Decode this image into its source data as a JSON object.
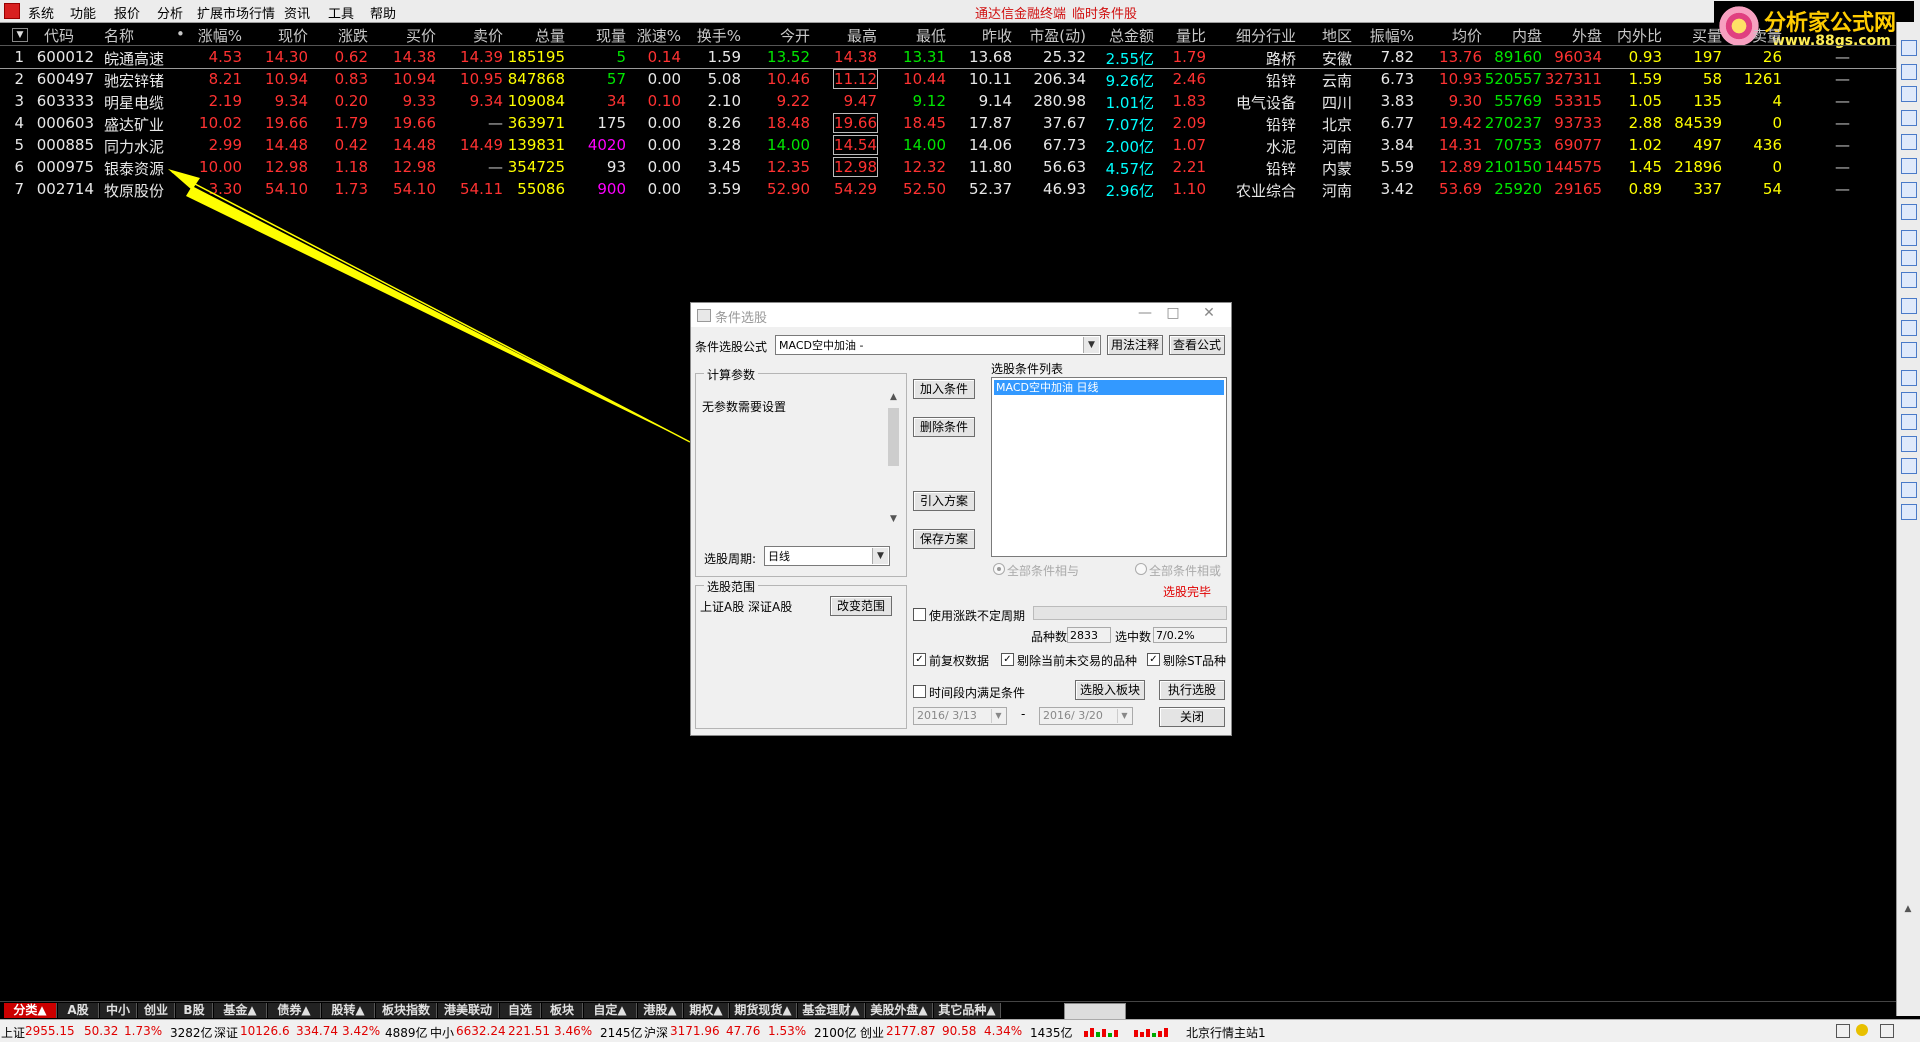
{
  "menubar": {
    "items": [
      "系统",
      "功能",
      "报价",
      "分析",
      "扩展市场行情",
      "资讯",
      "工具",
      "帮助"
    ],
    "title_left": "通达信金融终端",
    "title_right": "临时条件股",
    "restore_label": "行"
  },
  "brand": {
    "title": "分析家公式网",
    "url": "www.88gs.com"
  },
  "table": {
    "headers": [
      "代码",
      "名称",
      "•",
      "涨幅%",
      "现价",
      "涨跌",
      "买价",
      "卖价",
      "总量",
      "现量",
      "涨速%",
      "换手%",
      "今开",
      "最高",
      "最低",
      "昨收",
      "市盈(动)",
      "总金额",
      "量比",
      "细分行业",
      "地区",
      "振幅%",
      "均价",
      "内盘",
      "外盘",
      "内外比",
      "买量",
      "卖量"
    ],
    "rows": [
      {
        "idx": "1",
        "code": "600012",
        "name": "皖通高速",
        "chg_pct": "4.53",
        "price": "14.30",
        "chg": "0.62",
        "bid": "14.38",
        "ask": "14.39",
        "vol": "185195",
        "cur_vol": "5",
        "speed": "0.14",
        "turnover": "1.59",
        "open": "13.52",
        "high": "14.38",
        "low": "13.31",
        "prev": "13.68",
        "pe": "25.32",
        "amount": "2.55亿",
        "vol_ratio": "1.79",
        "industry": "路桥",
        "region": "安徽",
        "amplitude": "7.82",
        "avg": "13.76",
        "inner": "89160",
        "outer": "96034",
        "io_ratio": "0.93",
        "buy_vol": "197",
        "sell_vol": "26"
      },
      {
        "idx": "2",
        "code": "600497",
        "name": "驰宏锌锗",
        "chg_pct": "8.21",
        "price": "10.94",
        "chg": "0.83",
        "bid": "10.94",
        "ask": "10.95",
        "vol": "847868",
        "cur_vol": "57",
        "speed": "0.00",
        "turnover": "5.08",
        "open": "10.46",
        "high": "11.12",
        "low": "10.44",
        "prev": "10.11",
        "pe": "206.34",
        "amount": "9.26亿",
        "vol_ratio": "2.46",
        "industry": "铅锌",
        "region": "云南",
        "amplitude": "6.73",
        "avg": "10.93",
        "inner": "520557",
        "outer": "327311",
        "io_ratio": "1.59",
        "buy_vol": "58",
        "sell_vol": "1261"
      },
      {
        "idx": "3",
        "code": "603333",
        "name": "明星电缆",
        "chg_pct": "2.19",
        "price": "9.34",
        "chg": "0.20",
        "bid": "9.33",
        "ask": "9.34",
        "vol": "109084",
        "cur_vol": "34",
        "speed": "0.10",
        "turnover": "2.10",
        "open": "9.22",
        "high": "9.47",
        "low": "9.12",
        "prev": "9.14",
        "pe": "280.98",
        "amount": "1.01亿",
        "vol_ratio": "1.83",
        "industry": "电气设备",
        "region": "四川",
        "amplitude": "3.83",
        "avg": "9.30",
        "inner": "55769",
        "outer": "53315",
        "io_ratio": "1.05",
        "buy_vol": "135",
        "sell_vol": "4"
      },
      {
        "idx": "4",
        "code": "000603",
        "name": "盛达矿业",
        "chg_pct": "10.02",
        "price": "19.66",
        "chg": "1.79",
        "bid": "19.66",
        "ask": "—",
        "vol": "363971",
        "cur_vol": "175",
        "speed": "0.00",
        "turnover": "8.26",
        "open": "18.48",
        "high": "19.66",
        "low": "18.45",
        "prev": "17.87",
        "pe": "37.67",
        "amount": "7.07亿",
        "vol_ratio": "2.09",
        "industry": "铅锌",
        "region": "北京",
        "amplitude": "6.77",
        "avg": "19.42",
        "inner": "270237",
        "outer": "93733",
        "io_ratio": "2.88",
        "buy_vol": "84539",
        "sell_vol": "0"
      },
      {
        "idx": "5",
        "code": "000885",
        "name": "同力水泥",
        "chg_pct": "2.99",
        "price": "14.48",
        "chg": "0.42",
        "bid": "14.48",
        "ask": "14.49",
        "vol": "139831",
        "cur_vol": "4020",
        "speed": "0.00",
        "turnover": "3.28",
        "open": "14.00",
        "high": "14.54",
        "low": "14.00",
        "prev": "14.06",
        "pe": "67.73",
        "amount": "2.00亿",
        "vol_ratio": "1.07",
        "industry": "水泥",
        "region": "河南",
        "amplitude": "3.84",
        "avg": "14.31",
        "inner": "70753",
        "outer": "69077",
        "io_ratio": "1.02",
        "buy_vol": "497",
        "sell_vol": "436"
      },
      {
        "idx": "6",
        "code": "000975",
        "name": "银泰资源",
        "chg_pct": "10.00",
        "price": "12.98",
        "chg": "1.18",
        "bid": "12.98",
        "ask": "—",
        "vol": "354725",
        "cur_vol": "93",
        "speed": "0.00",
        "turnover": "3.45",
        "open": "12.35",
        "high": "12.98",
        "low": "12.32",
        "prev": "11.80",
        "pe": "56.63",
        "amount": "4.57亿",
        "vol_ratio": "2.21",
        "industry": "铅锌",
        "region": "内蒙",
        "amplitude": "5.59",
        "avg": "12.89",
        "inner": "210150",
        "outer": "144575",
        "io_ratio": "1.45",
        "buy_vol": "21896",
        "sell_vol": "0"
      },
      {
        "idx": "7",
        "code": "002714",
        "name": "牧原股份",
        "chg_pct": "3.30",
        "price": "54.10",
        "chg": "1.73",
        "bid": "54.10",
        "ask": "54.11",
        "vol": "55086",
        "cur_vol": "900",
        "speed": "0.00",
        "turnover": "3.59",
        "open": "52.90",
        "high": "54.29",
        "low": "52.50",
        "prev": "52.37",
        "pe": "46.93",
        "amount": "2.96亿",
        "vol_ratio": "1.10",
        "industry": "农业综合",
        "region": "河南",
        "amplitude": "3.42",
        "avg": "53.69",
        "inner": "25920",
        "outer": "29165",
        "io_ratio": "0.89",
        "buy_vol": "337",
        "sell_vol": "54"
      }
    ],
    "dash": "—"
  },
  "dialog": {
    "title": "条件选股",
    "formula_label": "条件选股公式",
    "formula_value": "MACD空中加油 -",
    "usage_button": "用法注释",
    "view_formula_button": "查看公式",
    "calc_params_title": "计算参数",
    "no_params_text": "无参数需要设置",
    "period_label": "选股周期:",
    "period_value": "日线",
    "condition_list_title": "选股条件列表",
    "condition_item": "MACD空中加油  日线",
    "add_button": "加入条件",
    "delete_button": "删除条件",
    "import_button": "引入方案",
    "save_button": "保存方案",
    "radio_and": "全部条件相与",
    "radio_or": "全部条件相或",
    "status_done": "选股完毕",
    "range_title": "选股范围",
    "range_value": "上证A股 深证A股",
    "change_range_button": "改变范围",
    "use_period_label": "使用涨跌不定周期",
    "count_label": "品种数",
    "count_value": "2833",
    "selected_label": "选中数",
    "selected_value": "7/0.2%",
    "checkbox_adjust": "前复权数据",
    "checkbox_exclude_suspended": "剔除当前未交易的品种",
    "checkbox_exclude_st": "剔除ST品种",
    "checkbox_time_range": "时间段内满足条件",
    "add_to_block_button": "选股入板块",
    "execute_button": "执行选股",
    "date_from": "2016/ 3/13",
    "date_to": "2016/ 3/20",
    "date_sep": "-",
    "close_button": "关闭"
  },
  "bottom_tabs": [
    "分类▲",
    "A股",
    "中小",
    "创业",
    "B股",
    "基金▲",
    "债券▲",
    "股转▲",
    "板块指数",
    "港美联动",
    "自选",
    "板块",
    "自定▲",
    "港股▲",
    "期权▲",
    "期货现货▲",
    "基金理财▲",
    "美股外盘▲",
    "其它品种▲"
  ],
  "statusbar": {
    "sh_label": "上证",
    "sh_value": "2955.15",
    "sh_chg": "50.32",
    "sh_pct": "1.73%",
    "sh_amt": "3282亿",
    "sz_label": "深证",
    "sz_value": "10126.6",
    "sz_chg": "334.74",
    "sz_pct": "3.42%",
    "sz_amt": "4889亿",
    "zx_label": "中小",
    "zx_value": "6632.24",
    "zx_chg": "221.51",
    "zx_pct": "3.46%",
    "zx_amt": "2145亿",
    "hs_label": "沪深",
    "hs_value": "3171.96",
    "hs_chg": "47.76",
    "hs_pct": "1.53%",
    "hs_amt": "2100亿",
    "cy_label": "创业",
    "cy_value": "2177.87",
    "cy_chg": "90.58",
    "cy_pct": "4.34%",
    "cy_amt": "1435亿",
    "server": "北京行情主站1"
  }
}
